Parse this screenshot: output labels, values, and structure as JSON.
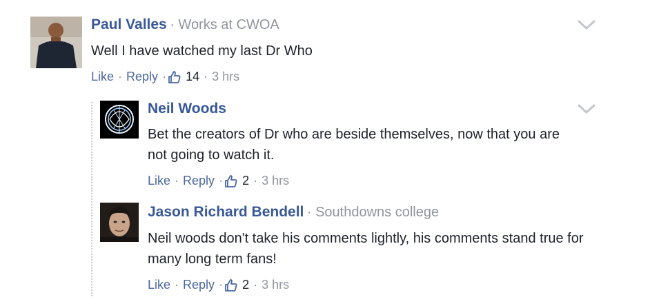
{
  "comments": [
    {
      "author": "Paul Valles",
      "subtitle": "Works at CWOA",
      "text": "Well I have watched my last Dr Who",
      "like": "Like",
      "reply": "Reply",
      "likes": "14",
      "time": "3 hrs"
    },
    {
      "author": "Neil Woods",
      "subtitle": "",
      "text": "Bet the creators of Dr who are beside themselves, now that you are not going to watch it.",
      "like": "Like",
      "reply": "Reply",
      "likes": "2",
      "time": "3 hrs"
    },
    {
      "author": "Jason Richard Bendell",
      "subtitle": "Southdowns college",
      "text": "Neil woods don't take his comments lightly, his comments stand true for many long term fans!",
      "like": "Like",
      "reply": "Reply",
      "likes": "2",
      "time": "3 hrs"
    }
  ],
  "colors": {
    "name": "#385898",
    "link": "#4b67a1",
    "meta": "#90949c",
    "text": "#1d2129"
  }
}
